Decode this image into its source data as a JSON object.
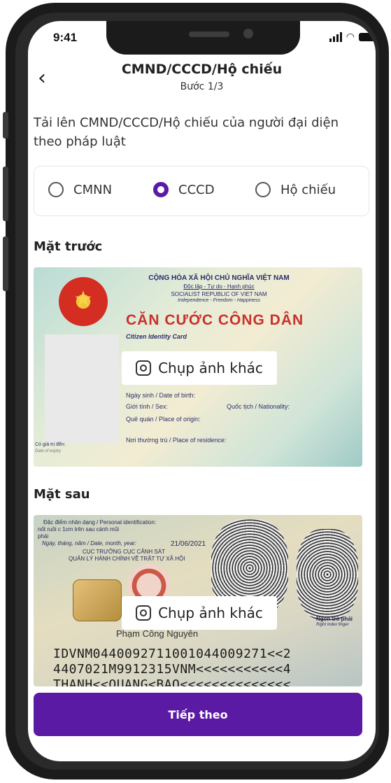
{
  "status_bar": {
    "time": "9:41"
  },
  "header": {
    "title": "CMND/CCCD/Hộ chiếu",
    "step": "Bước 1/3",
    "back_icon": "chevron-left-icon"
  },
  "instruction": "Tải lên CMND/CCCD/Hộ chiếu của người đại diện theo pháp luật",
  "doc_type": {
    "options": [
      {
        "label": "CMNN",
        "selected": false
      },
      {
        "label": "CCCD",
        "selected": true
      },
      {
        "label": "Hộ chiếu",
        "selected": false
      }
    ],
    "accent_color": "#5b1aa3"
  },
  "front": {
    "section_title": "Mặt trước",
    "retake_label": "Chụp ảnh khác",
    "card_text": {
      "republic": "CỘNG HÒA XÃ HỘI CHỦ NGHĨA VIỆT NAM",
      "motto": "Độc lập - Tự do - Hạnh phúc",
      "republic_en": "SOCIALIST REPUBLIC OF VIET NAM",
      "motto_en": "Independence - Freedom - Happiness",
      "card_title": "CĂN CƯỚC CÔNG DÂN",
      "card_title_en": "Citizen Identity Card",
      "dob": "Ngày sinh / Date of birth:",
      "sex": "Giới tính / Sex:",
      "nationality": "Quốc tịch / Nationality:",
      "origin": "Quê quán / Place of origin:",
      "residence": "Nơi thường trú / Place of residence:",
      "expiry": "Có giá trị đến:",
      "expiry_en": "Date of expiry"
    }
  },
  "back": {
    "section_title": "Mặt sau",
    "retake_label": "Chụp ảnh khác",
    "card_text": {
      "ident_label": "Đặc điểm nhân dạng / Personal identification:",
      "ident_value": "nốt ruồi c 1cm trên sau cánh mũi",
      "ident_value2": "phải",
      "date_label": "Ngày, tháng, năm / Date, month, year:",
      "date_value": "21/06/2021",
      "issuer1": "CỤC TRƯỞNG CỤC CẢNH SÁT",
      "issuer2": "QUẢN LÝ HÀNH CHÍNH VỀ TRẬT TỰ XÃ HỘI",
      "signer": "Phạm Công Nguyên",
      "right_index": "Ngón trỏ phải",
      "right_index_en": "Right index finger",
      "mrz1": "IDVNM0440092711001044009271<<2",
      "mrz2": "4407021M9912315VNM<<<<<<<<<<<4",
      "mrz3": "THANH<<QUANG<BAO<<<<<<<<<<<<<<"
    }
  },
  "primary_button": "Tiếp theo"
}
